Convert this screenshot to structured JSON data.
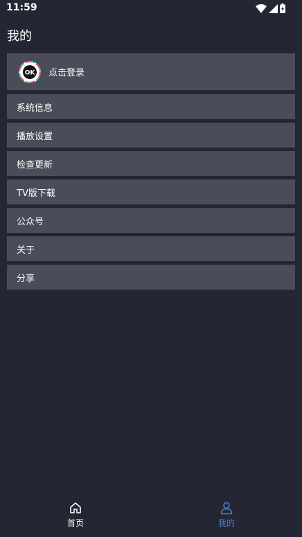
{
  "status_bar": {
    "time": "11:59",
    "icons": [
      "wifi-icon",
      "cell-signal-icon",
      "battery-charging-icon"
    ]
  },
  "page": {
    "title": "我的"
  },
  "login": {
    "label": "点击登录",
    "avatar_text": "OK"
  },
  "menu": {
    "items": [
      {
        "label": "系统信息"
      },
      {
        "label": "播放设置"
      },
      {
        "label": "检查更新"
      },
      {
        "label": "TV版下载"
      },
      {
        "label": "公众号"
      },
      {
        "label": "关于"
      },
      {
        "label": "分享"
      }
    ]
  },
  "bottom_nav": {
    "tabs": [
      {
        "label": "首页",
        "icon": "home-icon",
        "active": false
      },
      {
        "label": "我的",
        "icon": "user-icon",
        "active": true
      }
    ]
  },
  "colors": {
    "background": "#252634",
    "card": "#4b4c59",
    "accent": "#3b82d6"
  }
}
